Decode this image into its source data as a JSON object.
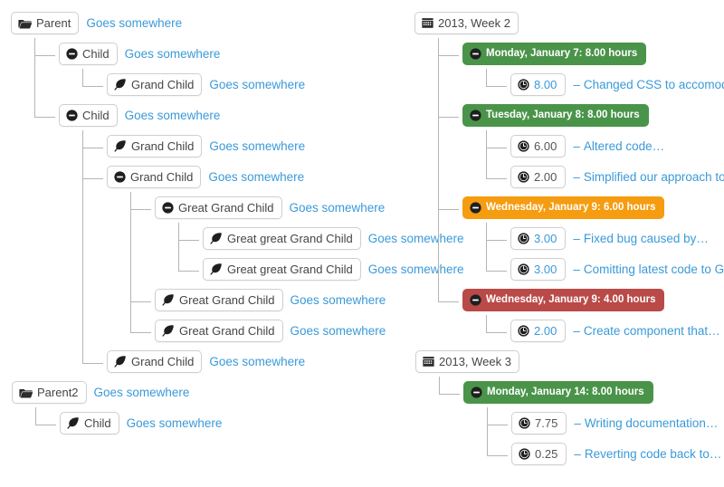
{
  "meta": {
    "link_color": "#3a9ad9",
    "chip_border": "#cfcfcf",
    "line_color": "#b5b5b5",
    "badge_green": "#4a944a",
    "badge_orange": "#f59c10",
    "badge_red": "#b94a48"
  },
  "common": {
    "goes_somewhere": "Goes somewhere",
    "dash": "–"
  },
  "left_tree": {
    "nodes": [
      {
        "id": "parent",
        "label": "Parent",
        "icon": "folder-icon",
        "link": "Goes somewhere",
        "children": [
          {
            "id": "child-1",
            "label": "Child",
            "icon": "minus-circle-icon",
            "link": "Goes somewhere",
            "children": [
              {
                "id": "grand-child-1",
                "label": "Grand Child",
                "icon": "leaf-icon",
                "link": "Goes somewhere",
                "children": []
              }
            ]
          },
          {
            "id": "child-2",
            "label": "Child",
            "icon": "minus-circle-icon",
            "link": "Goes somewhere",
            "children": [
              {
                "id": "grand-child-2",
                "label": "Grand Child",
                "icon": "leaf-icon",
                "link": "Goes somewhere",
                "children": []
              },
              {
                "id": "grand-child-3",
                "label": "Grand Child",
                "icon": "minus-circle-icon",
                "link": "Goes somewhere",
                "children": [
                  {
                    "id": "great-grand-child-1",
                    "label": "Great Grand Child",
                    "icon": "minus-circle-icon",
                    "link": "Goes somewhere",
                    "children": [
                      {
                        "id": "great-great-grand-child-1",
                        "label": "Great great Grand Child",
                        "icon": "leaf-icon",
                        "link": "Goes somewhere",
                        "children": []
                      },
                      {
                        "id": "great-great-grand-child-2",
                        "label": "Great great Grand Child",
                        "icon": "leaf-icon",
                        "link": "Goes somewhere",
                        "children": []
                      }
                    ]
                  },
                  {
                    "id": "great-grand-child-2",
                    "label": "Great Grand Child",
                    "icon": "leaf-icon",
                    "link": "Goes somewhere",
                    "children": []
                  },
                  {
                    "id": "great-grand-child-3",
                    "label": "Great Grand Child",
                    "icon": "leaf-icon",
                    "link": "Goes somewhere",
                    "children": []
                  }
                ]
              },
              {
                "id": "grand-child-4",
                "label": "Grand Child",
                "icon": "leaf-icon",
                "link": "Goes somewhere",
                "children": []
              }
            ]
          }
        ]
      },
      {
        "id": "parent2",
        "label": "Parent2",
        "icon": "folder-icon",
        "link": "Goes somewhere",
        "children": [
          {
            "id": "parent2-child-1",
            "label": "Child",
            "icon": "leaf-icon",
            "link": "Goes somewhere",
            "children": []
          }
        ]
      }
    ]
  },
  "right_tree": {
    "weeks": [
      {
        "id": "week-2",
        "label": "2013, Week 2",
        "icon": "calendar-icon",
        "days": [
          {
            "id": "mon-jan-7",
            "label": "Monday, January 7: 8.00 hours",
            "icon": "minus-circle-icon",
            "color": "green",
            "entries": [
              {
                "id": "entry-8-00",
                "time": "8.00",
                "icon": "clock-icon",
                "time_style": "linked",
                "dash": "–",
                "description": "Changed CSS to accomodate…"
              }
            ]
          },
          {
            "id": "tue-jan-8",
            "label": "Tuesday, January 8: 8.00 hours",
            "icon": "minus-circle-icon",
            "color": "green",
            "entries": [
              {
                "id": "entry-6-00",
                "time": "6.00",
                "icon": "clock-icon",
                "time_style": "plain",
                "dash": "–",
                "description": "Altered code…"
              },
              {
                "id": "entry-2-00-a",
                "time": "2.00",
                "icon": "clock-icon",
                "time_style": "plain",
                "dash": "–",
                "description": "Simplified our approach to…"
              }
            ]
          },
          {
            "id": "wed-jan-9-6h",
            "label": "Wednesday, January 9: 6.00 hours",
            "icon": "minus-circle-icon",
            "color": "orange",
            "entries": [
              {
                "id": "entry-3-00-a",
                "time": "3.00",
                "icon": "clock-icon",
                "time_style": "linked",
                "dash": "–",
                "description": "Fixed bug caused by…"
              },
              {
                "id": "entry-3-00-b",
                "time": "3.00",
                "icon": "clock-icon",
                "time_style": "linked",
                "dash": "–",
                "description": "Comitting latest code to Git…"
              }
            ]
          },
          {
            "id": "wed-jan-9-4h",
            "label": "Wednesday, January 9: 4.00 hours",
            "icon": "minus-circle-icon",
            "color": "red",
            "entries": [
              {
                "id": "entry-2-00-b",
                "time": "2.00",
                "icon": "clock-icon",
                "time_style": "linked",
                "dash": "–",
                "description": "Create component that…"
              }
            ]
          }
        ]
      },
      {
        "id": "week-3",
        "label": "2013, Week 3",
        "icon": "calendar-icon",
        "days": [
          {
            "id": "mon-jan-14",
            "label": "Monday, January 14: 8.00 hours",
            "icon": "minus-circle-icon",
            "color": "green",
            "entries": [
              {
                "id": "entry-7-75",
                "time": "7.75",
                "icon": "clock-icon",
                "time_style": "plain",
                "dash": "–",
                "description": "Writing documentation…"
              },
              {
                "id": "entry-0-25",
                "time": "0.25",
                "icon": "clock-icon",
                "time_style": "plain",
                "dash": "–",
                "description": "Reverting code back to…"
              }
            ]
          }
        ]
      }
    ]
  }
}
